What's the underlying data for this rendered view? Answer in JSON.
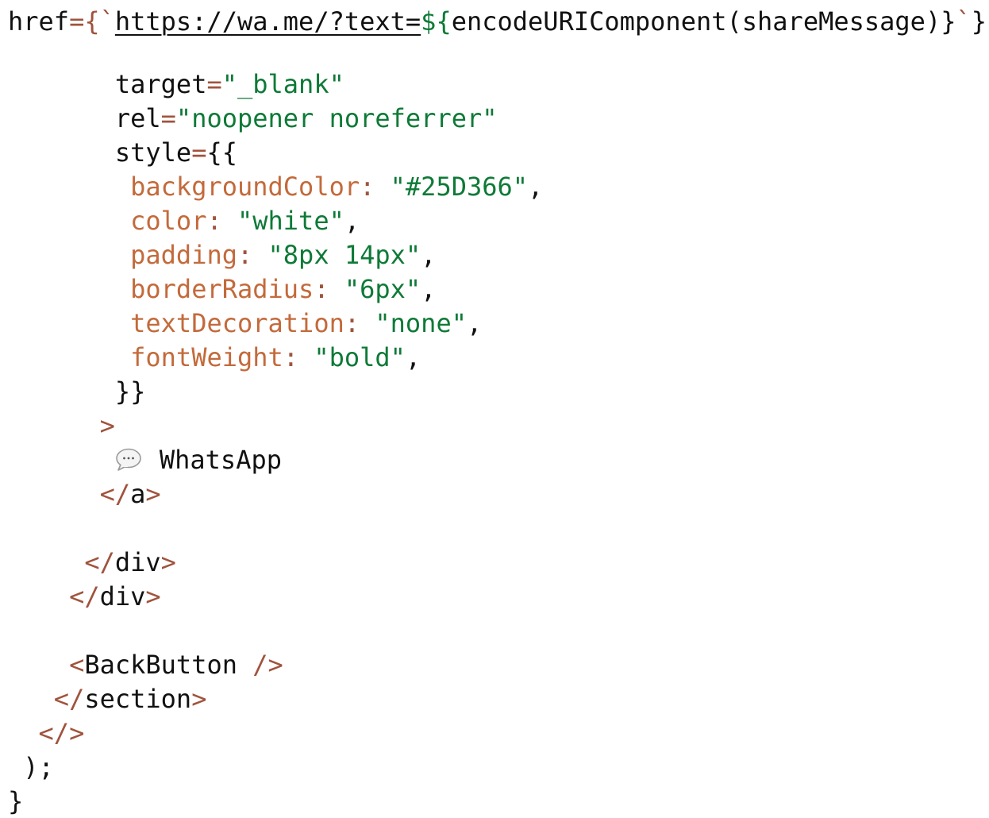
{
  "editor": {
    "colors": {
      "background": "#ffffff",
      "plain": "#111111",
      "punctuation": "#a0533d",
      "string": "#0e7a37",
      "property": "#c36a3b"
    },
    "lines": [
      {
        "tokens": [
          {
            "t": "href",
            "c": "plain"
          },
          {
            "t": "={",
            "c": "punct"
          },
          {
            "t": "`",
            "c": "punct"
          },
          {
            "t": "https://wa.me/?text=",
            "c": "link"
          },
          {
            "t": "${",
            "c": "str"
          },
          {
            "t": "encodeURIComponent(shareMessage)",
            "c": "plain"
          },
          {
            "t": "}",
            "c": "plain"
          },
          {
            "t": "`",
            "c": "punct"
          },
          {
            "t": "}",
            "c": "plain"
          }
        ]
      },
      {
        "tokens": [
          {
            "t": "       target",
            "c": "plain"
          },
          {
            "t": "=",
            "c": "punct"
          },
          {
            "t": "\"_blank\"",
            "c": "str"
          }
        ]
      },
      {
        "tokens": [
          {
            "t": "       rel",
            "c": "plain"
          },
          {
            "t": "=",
            "c": "punct"
          },
          {
            "t": "\"noopener noreferrer\"",
            "c": "str"
          }
        ]
      },
      {
        "tokens": [
          {
            "t": "       style",
            "c": "plain"
          },
          {
            "t": "=",
            "c": "punct"
          },
          {
            "t": "{{",
            "c": "plain"
          }
        ]
      },
      {
        "tokens": [
          {
            "t": "        backgroundColor",
            "c": "key"
          },
          {
            "t": ": ",
            "c": "punct"
          },
          {
            "t": "\"#25D366\"",
            "c": "str"
          },
          {
            "t": ",",
            "c": "plain"
          }
        ]
      },
      {
        "tokens": [
          {
            "t": "        color",
            "c": "key"
          },
          {
            "t": ": ",
            "c": "punct"
          },
          {
            "t": "\"white\"",
            "c": "str"
          },
          {
            "t": ",",
            "c": "plain"
          }
        ]
      },
      {
        "tokens": [
          {
            "t": "        padding",
            "c": "key"
          },
          {
            "t": ": ",
            "c": "punct"
          },
          {
            "t": "\"8px 14px\"",
            "c": "str"
          },
          {
            "t": ",",
            "c": "plain"
          }
        ]
      },
      {
        "tokens": [
          {
            "t": "        borderRadius",
            "c": "key"
          },
          {
            "t": ": ",
            "c": "punct"
          },
          {
            "t": "\"6px\"",
            "c": "str"
          },
          {
            "t": ",",
            "c": "plain"
          }
        ]
      },
      {
        "tokens": [
          {
            "t": "        textDecoration",
            "c": "key"
          },
          {
            "t": ": ",
            "c": "punct"
          },
          {
            "t": "\"none\"",
            "c": "str"
          },
          {
            "t": ",",
            "c": "plain"
          }
        ]
      },
      {
        "tokens": [
          {
            "t": "        fontWeight",
            "c": "key"
          },
          {
            "t": ": ",
            "c": "punct"
          },
          {
            "t": "\"bold\"",
            "c": "str"
          },
          {
            "t": ",",
            "c": "plain"
          }
        ]
      },
      {
        "tokens": [
          {
            "t": "       }}",
            "c": "plain"
          }
        ]
      },
      {
        "tokens": [
          {
            "t": "      >",
            "c": "punct"
          }
        ]
      },
      {
        "tokens": [
          {
            "t": "       ",
            "c": "plain"
          },
          {
            "t": "ICON",
            "c": "icon"
          },
          {
            "t": "WhatsApp",
            "c": "plain"
          }
        ]
      },
      {
        "tokens": [
          {
            "t": "      </",
            "c": "punct"
          },
          {
            "t": "a",
            "c": "plain"
          },
          {
            "t": ">",
            "c": "punct"
          }
        ]
      },
      {
        "tokens": []
      },
      {
        "tokens": [
          {
            "t": "     </",
            "c": "punct"
          },
          {
            "t": "div",
            "c": "plain"
          },
          {
            "t": ">",
            "c": "punct"
          }
        ]
      },
      {
        "tokens": [
          {
            "t": "    </",
            "c": "punct"
          },
          {
            "t": "div",
            "c": "plain"
          },
          {
            "t": ">",
            "c": "punct"
          }
        ]
      },
      {
        "tokens": []
      },
      {
        "tokens": [
          {
            "t": "    <",
            "c": "punct"
          },
          {
            "t": "BackButton ",
            "c": "plain"
          },
          {
            "t": "/>",
            "c": "punct"
          }
        ]
      },
      {
        "tokens": [
          {
            "t": "   </",
            "c": "punct"
          },
          {
            "t": "section",
            "c": "plain"
          },
          {
            "t": ">",
            "c": "punct"
          }
        ]
      },
      {
        "tokens": [
          {
            "t": "  </>",
            "c": "punct"
          }
        ]
      },
      {
        "tokens": [
          {
            "t": " );",
            "c": "plain"
          }
        ]
      },
      {
        "tokens": [
          {
            "t": "}",
            "c": "plain"
          }
        ]
      }
    ],
    "icon_name": "speech-bubble-icon"
  }
}
